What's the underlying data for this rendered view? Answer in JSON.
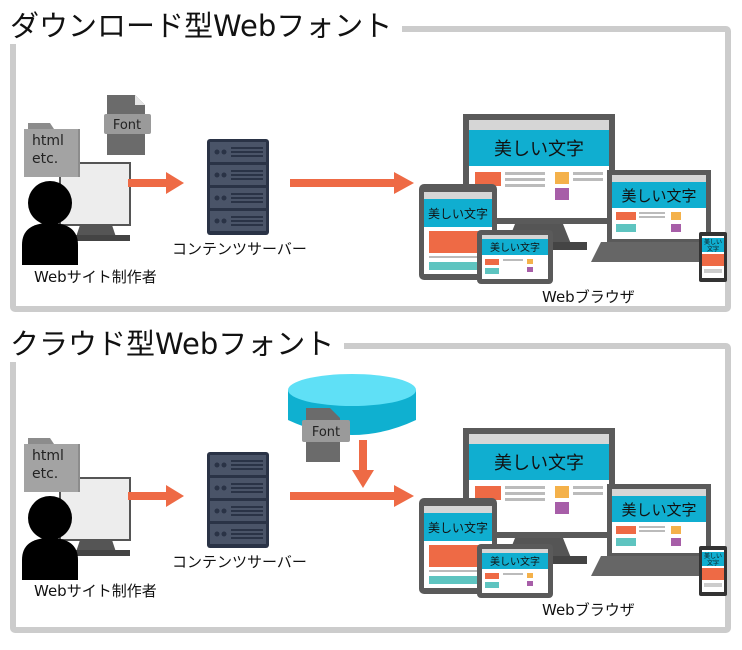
{
  "sections": [
    {
      "title": "ダウンロード型Webフォント",
      "creator": {
        "label": "Webサイト制作者",
        "folder_line1": "html",
        "folder_line2": "etc.",
        "font_file_label": "Font"
      },
      "server": {
        "label": "コンテンツサーバー"
      },
      "browser": {
        "label": "Webブラウザ",
        "screen_text": "美しい文字",
        "phone_line1": "美しい",
        "phone_line2": "文字"
      }
    },
    {
      "title": "クラウド型Webフォント",
      "creator": {
        "label": "Webサイト制作者",
        "folder_line1": "html",
        "folder_line2": "etc."
      },
      "cloud_db": {
        "font_file_label": "Font"
      },
      "server": {
        "label": "コンテンツサーバー"
      },
      "browser": {
        "label": "Webブラウザ",
        "screen_text": "美しい文字",
        "phone_line1": "美しい",
        "phone_line2": "文字"
      }
    }
  ],
  "colors": {
    "arrow": "#ee6a45",
    "panel_border": "#cccccc",
    "server": "#343f55",
    "screen_header": "#10aed0",
    "cloud": "#1fb8d8",
    "device_frame": "#5a5a5a"
  }
}
